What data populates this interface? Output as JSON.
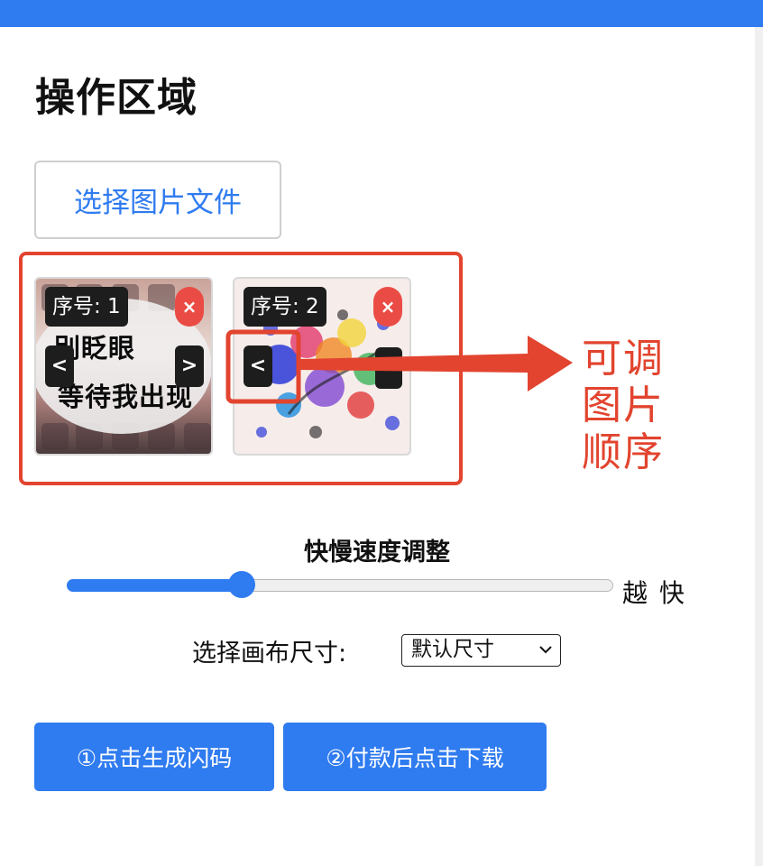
{
  "header": {
    "bar_color": "#2f7bf0"
  },
  "page_title": "操作区域",
  "file_button": {
    "label": "选择图片文件"
  },
  "images": [
    {
      "seq_label": "序号: 1",
      "close_icon": "×",
      "prev_label": "<",
      "next_label": ">",
      "text_line1": "别眨眼",
      "text_line2": "等待我出现"
    },
    {
      "seq_label": "序号: 2",
      "close_icon": "×",
      "prev_label": "<"
    }
  ],
  "annotation": {
    "text": "可调图片顺序",
    "color": "#e2442f"
  },
  "speed": {
    "title": "快慢速度调整",
    "value": 0.32,
    "label": "越 快"
  },
  "canvas_size": {
    "label": "选择画布尺寸:",
    "selected": "默认尺寸"
  },
  "actions": {
    "generate": "①点击生成闪码",
    "download": "②付款后点击下载"
  },
  "colors": {
    "accent": "#2f7bf0",
    "close": "#ea4c45"
  }
}
